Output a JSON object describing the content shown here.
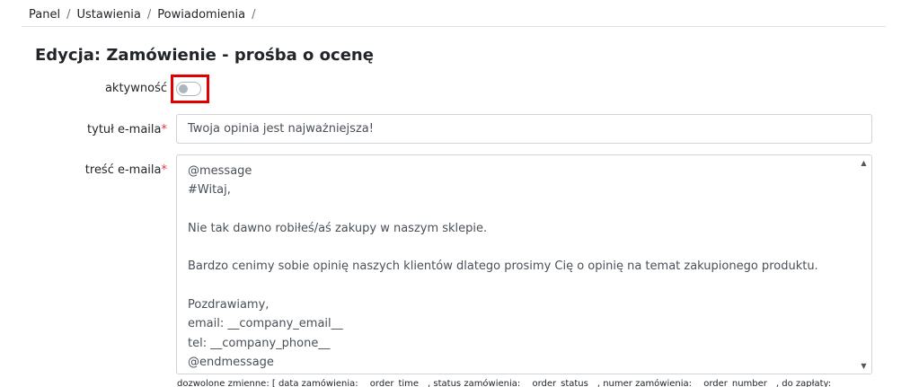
{
  "breadcrumb": {
    "items": [
      "Panel",
      "Ustawienia",
      "Powiadomienia"
    ],
    "separator": "/"
  },
  "page": {
    "title": "Edycja: Zamówienie - prośba o ocenę"
  },
  "form": {
    "active_label": "aktywność",
    "active_value": false,
    "title_label": "tytuł e-maila",
    "title_value": "Twoja opinia jest najważniejsza!",
    "body_label": "treść e-maila",
    "required_mark": "*",
    "body_lines": [
      "@message",
      "#Witaj,",
      "",
      "Nie tak dawno robiłeś/aś zakupy w naszym sklepie.",
      "",
      "Bardzo cenimy sobie opinię naszych klientów dlatego prosimy Cię o opinię na temat zakupionego produktu.",
      "",
      "Pozdrawiamy,",
      "email: __company_email__",
      "tel: __company_phone__",
      "@endmessage"
    ],
    "variables_hint": "dozwolone zmienne: [ data zamówienia: __order_time__, status zamówienia: __order_status__, numer zamówienia: __order_number__, do zapłaty: __"
  },
  "colors": {
    "highlight": "#e00000",
    "required": "#dc3545"
  },
  "icons": {
    "scroll_up": "chevron-up-icon",
    "scroll_down": "chevron-down-icon"
  }
}
